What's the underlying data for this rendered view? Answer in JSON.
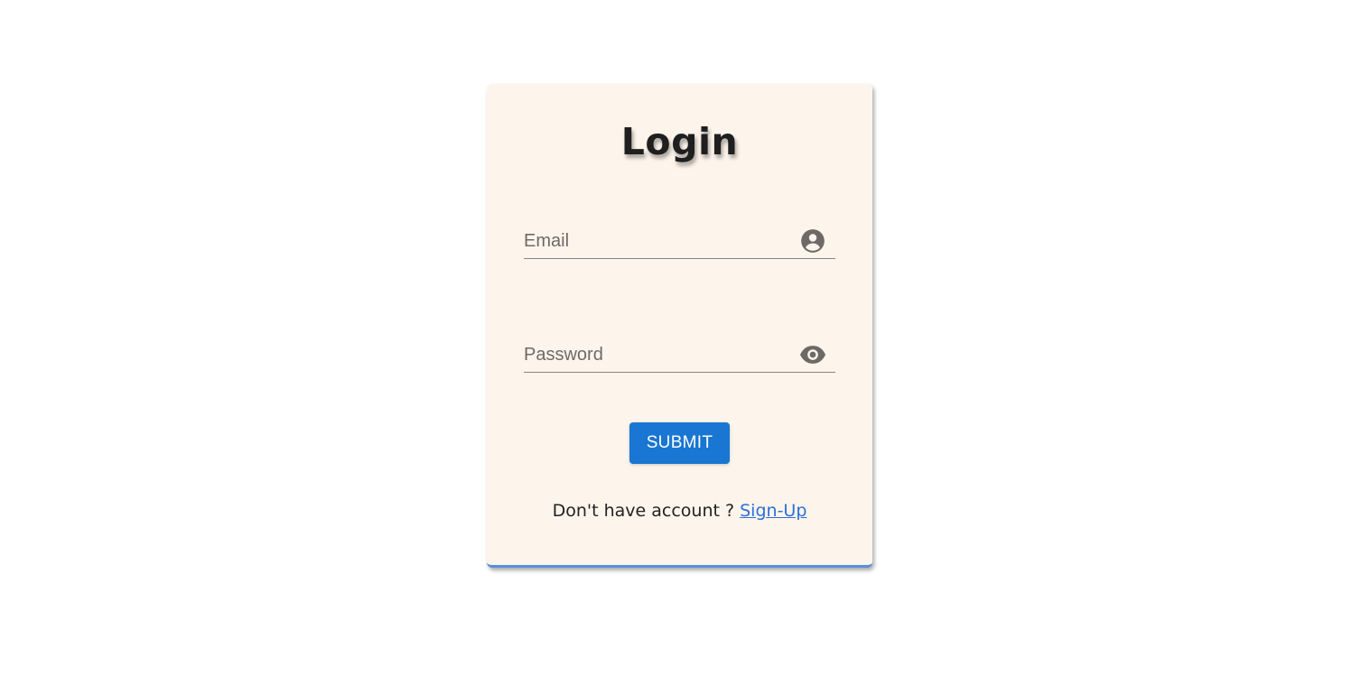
{
  "login_card": {
    "title": "Login",
    "email_field": {
      "placeholder": "Email",
      "value": "",
      "icon": "account-circle-icon"
    },
    "password_field": {
      "placeholder": "Password",
      "value": "",
      "icon": "eye-icon"
    },
    "submit_label": "SUBMIT",
    "signup_prompt": "Don't have account ?",
    "signup_link": "Sign-Up"
  },
  "colors": {
    "card_background": "#fdf5ec",
    "button": "#1976d2",
    "link": "#2f6fd6",
    "card_bottom_border": "#5b8fd9",
    "icon": "#6d6a66"
  }
}
